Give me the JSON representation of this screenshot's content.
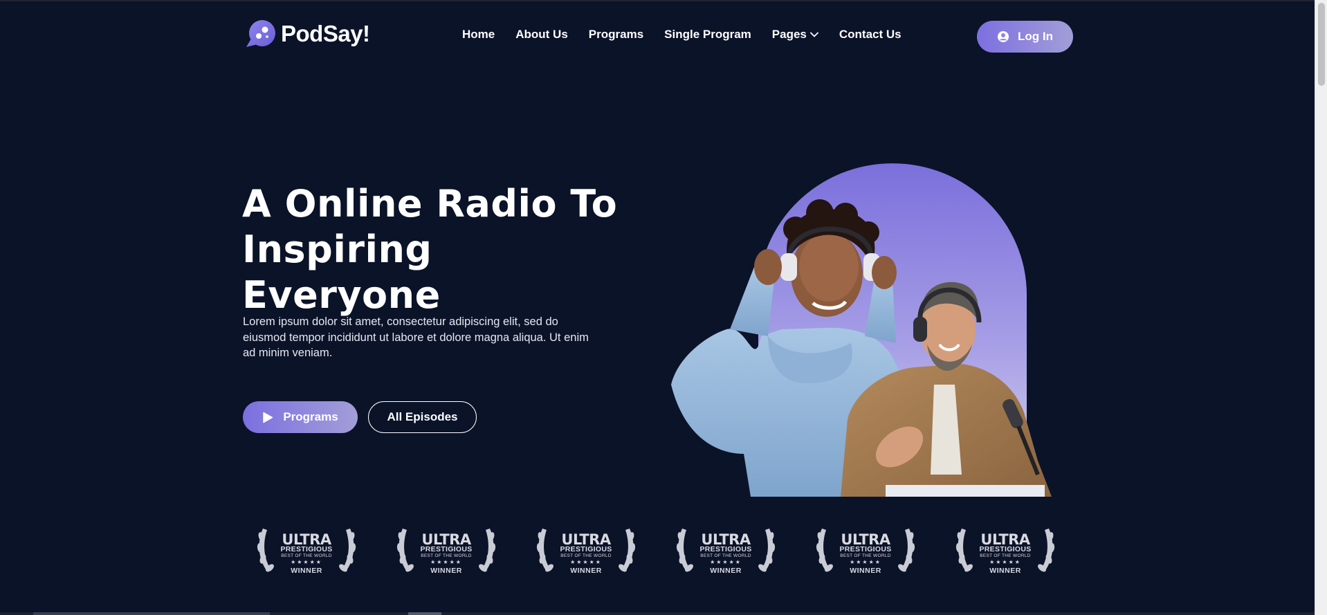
{
  "brand": {
    "name": "PodSay!",
    "logo_icon": "chat-bubble-icon",
    "accent": "#7c6fe0",
    "accent_light": "#a29ed8",
    "background": "#0b1329"
  },
  "nav": {
    "items": [
      {
        "label": "Home"
      },
      {
        "label": "About Us"
      },
      {
        "label": "Programs"
      },
      {
        "label": "Single Program"
      },
      {
        "label": "Pages",
        "icon": "chevron-down-icon"
      },
      {
        "label": "Contact Us"
      }
    ]
  },
  "header": {
    "login_label": "Log In",
    "login_icon": "user-circle-icon"
  },
  "hero": {
    "title_line1": "A Online Radio To",
    "title_line2": "Inspiring Everyone",
    "description": "Lorem ipsum dolor sit amet, consectetur adipiscing elit, sed do eiusmod tempor incididunt ut labore et dolore magna aliqua. Ut enim ad minim veniam.",
    "primary_button": {
      "label": "Programs",
      "icon": "play-icon"
    },
    "secondary_button": {
      "label": "All Episodes"
    },
    "image": {
      "description": "two-hosts-with-headphones-photo",
      "arch_color": "#8a7fe0"
    }
  },
  "awards": [
    {
      "title": "ULTRA",
      "subtitle": "PRESTIGIOUS",
      "tagline": "BEST OF THE WORLD",
      "stars": "★★★★★",
      "label": "WINNER"
    },
    {
      "title": "ULTRA",
      "subtitle": "PRESTIGIOUS",
      "tagline": "BEST OF THE WORLD",
      "stars": "★★★★★",
      "label": "WINNER"
    },
    {
      "title": "ULTRA",
      "subtitle": "PRESTIGIOUS",
      "tagline": "BEST OF THE WORLD",
      "stars": "★★★★★",
      "label": "WINNER"
    },
    {
      "title": "ULTRA",
      "subtitle": "PRESTIGIOUS",
      "tagline": "BEST OF THE WORLD",
      "stars": "★★★★★",
      "label": "WINNER"
    },
    {
      "title": "ULTRA",
      "subtitle": "PRESTIGIOUS",
      "tagline": "BEST OF THE WORLD",
      "stars": "★★★★★",
      "label": "WINNER"
    },
    {
      "title": "ULTRA",
      "subtitle": "PRESTIGIOUS",
      "tagline": "BEST OF THE WORLD",
      "stars": "★★★★★",
      "label": "WINNER"
    }
  ]
}
